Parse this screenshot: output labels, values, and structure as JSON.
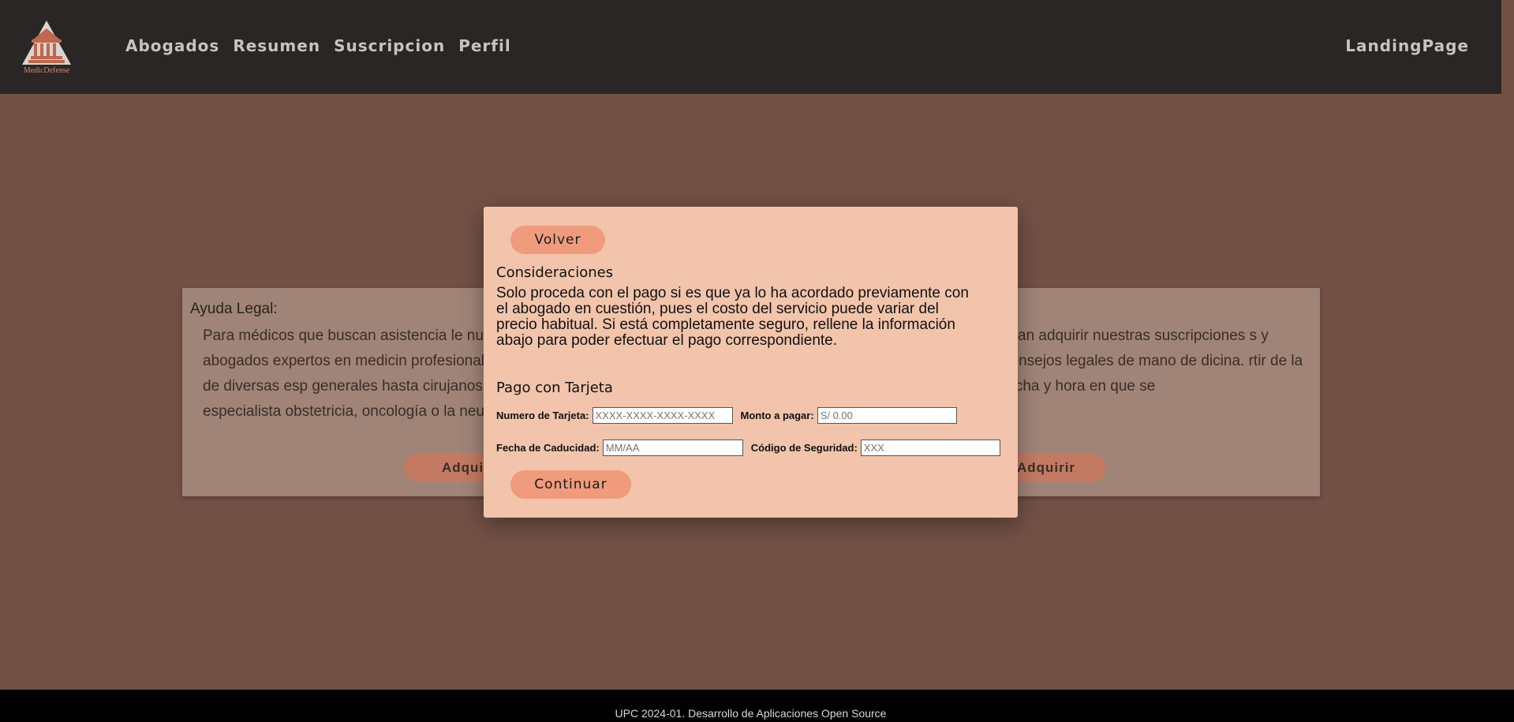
{
  "header": {
    "logo_text": "MedicDefense",
    "nav": [
      "Abogados",
      "Resumen",
      "Suscripcion",
      "Perfil"
    ],
    "right_link": "LandingPage"
  },
  "cards": {
    "left_title": "Ayuda Legal:",
    "left_text": "Para médicos que buscan asistencia le nuestros abogados expertos en medicin profesionales médicos de diversas esp generales hasta cirujanos y especialista obstetricia, oncología o la neurología.",
    "right_text": "scan adquirir nuestras suscripciones s y consejos legales de mano de dicina. rtir de la fecha y hora en que se",
    "left_button": "Adquirir",
    "right_button": "Adquirir"
  },
  "modal": {
    "back_button": "Volver",
    "considerations_title": "Consideraciones",
    "considerations_text": "Solo proceda con el pago si es que ya lo ha acordado previamente con el abogado en cuestión, pues el costo del servicio puede variar del precio habitual. Si está completamente seguro, rellene la información abajo para poder efectuar el pago correspondiente.",
    "payment_title": "Pago con Tarjeta",
    "fields": {
      "card_number_label": "Numero de Tarjeta:",
      "card_number_placeholder": "XXXX-XXXX-XXXX-XXXX",
      "amount_label": "Monto a pagar:",
      "amount_placeholder": "S/ 0.00",
      "expiry_label": "Fecha de Caducidad:",
      "expiry_placeholder": "MM/AA",
      "cvv_label": "Código de Seguridad:",
      "cvv_placeholder": "XXX"
    },
    "continue_button": "Continuar"
  },
  "footer": {
    "text": "UPC 2024-01. Desarrollo de Aplicaciones Open Source"
  },
  "colors": {
    "header_bg": "#2a2626",
    "page_bg": "#725045",
    "modal_bg": "#f2c4ab",
    "button_bg": "#f09b7d"
  }
}
